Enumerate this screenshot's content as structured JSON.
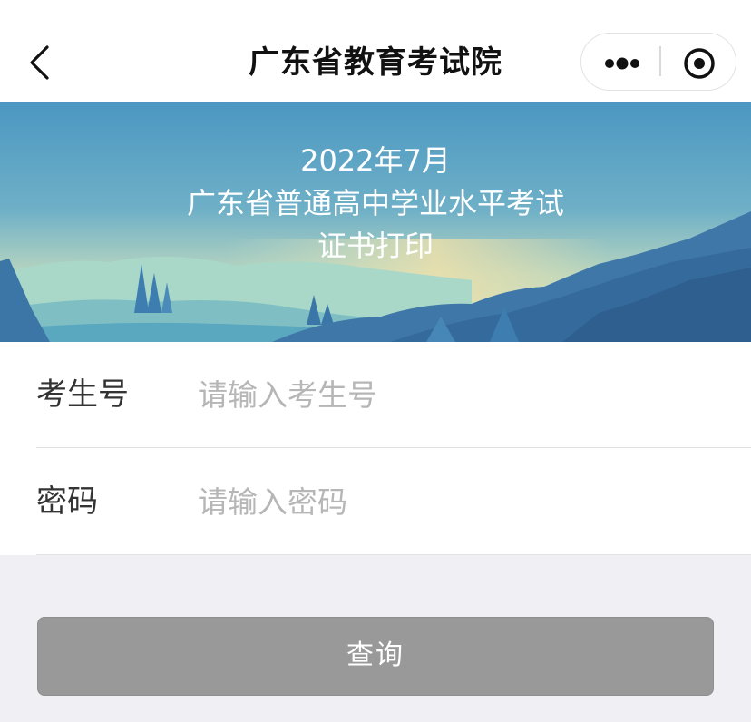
{
  "navbar": {
    "title": "广东省教育考试院"
  },
  "banner": {
    "line1": "2022年7月",
    "line2": "广东省普通高中学业水平考试",
    "line3": "证书打印"
  },
  "form": {
    "exam_id": {
      "label": "考生号",
      "value": "",
      "placeholder": "请输入考生号"
    },
    "password": {
      "label": "密码",
      "value": "",
      "placeholder": "请输入密码"
    }
  },
  "actions": {
    "query_label": "查询"
  },
  "colors": {
    "button_bg": "#999999",
    "page_bg": "#efeff4",
    "banner_sky_top": "#4a95c0",
    "banner_mountain": "#356a9c"
  },
  "icons": {
    "back": "chevron-left-icon",
    "more": "more-dots-icon",
    "close": "target-close-icon"
  }
}
